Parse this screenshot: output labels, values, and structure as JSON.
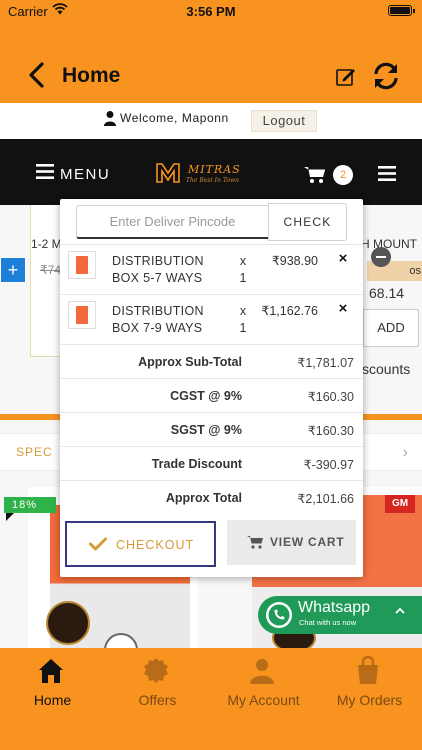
{
  "status_bar": {
    "carrier": "Carrier",
    "time": "3:56 PM"
  },
  "nav": {
    "title": "Home"
  },
  "welcome": {
    "text": "Welcome, Maponn",
    "logout_label": "Logout"
  },
  "menubar": {
    "menu_label": "MENU",
    "brand": "MITRAS",
    "tagline": "The Best In Town",
    "cart_count": "2"
  },
  "background": {
    "left_product_name": "1-2 M",
    "left_product_price": "₹74",
    "right_product_name": "H MOUNT",
    "right_product_tag": "os",
    "right_product_price": "68.14",
    "right_add_label": "ADD",
    "discounts_text": "scounts",
    "special_label": "SPEC",
    "discount_badge": "18%",
    "gm_logo": "GM"
  },
  "cart_popover": {
    "pincode_placeholder": "Enter Deliver Pincode",
    "pincode_value": "",
    "check_label": "CHECK",
    "items": [
      {
        "name": "DISTRIBUTION BOX 5-7 WAYS",
        "multiplier": "x",
        "quantity": "1",
        "amount": "₹938.90"
      },
      {
        "name": "DISTRIBUTION BOX 7-9 WAYS",
        "multiplier": "x",
        "quantity": "1",
        "amount": "₹1,162.76"
      }
    ],
    "summary": [
      {
        "label": "Approx Sub-Total",
        "value": "₹1,781.07"
      },
      {
        "label": "CGST @ 9%",
        "value": "₹160.30"
      },
      {
        "label": "SGST @ 9%",
        "value": "₹160.30"
      },
      {
        "label": "Trade Discount",
        "value": "₹-390.97"
      },
      {
        "label": "Approx Total",
        "value": "₹2,101.66"
      }
    ],
    "checkout_label": "CHECKOUT",
    "view_cart_label": "VIEW CART"
  },
  "whatsapp": {
    "title": "Whatsapp",
    "subtitle": "Chat with us now"
  },
  "tabs": [
    {
      "label": "Home",
      "icon": "home-icon"
    },
    {
      "label": "Offers",
      "icon": "offers-icon"
    },
    {
      "label": "My Account",
      "icon": "account-icon"
    },
    {
      "label": "My Orders",
      "icon": "orders-icon"
    }
  ],
  "colors": {
    "primary_orange": "#f7931e",
    "menubar_black": "#111111",
    "whatsapp_green": "#1f9a59",
    "checkout_border": "#393980",
    "accent_gold": "#d69a35"
  }
}
